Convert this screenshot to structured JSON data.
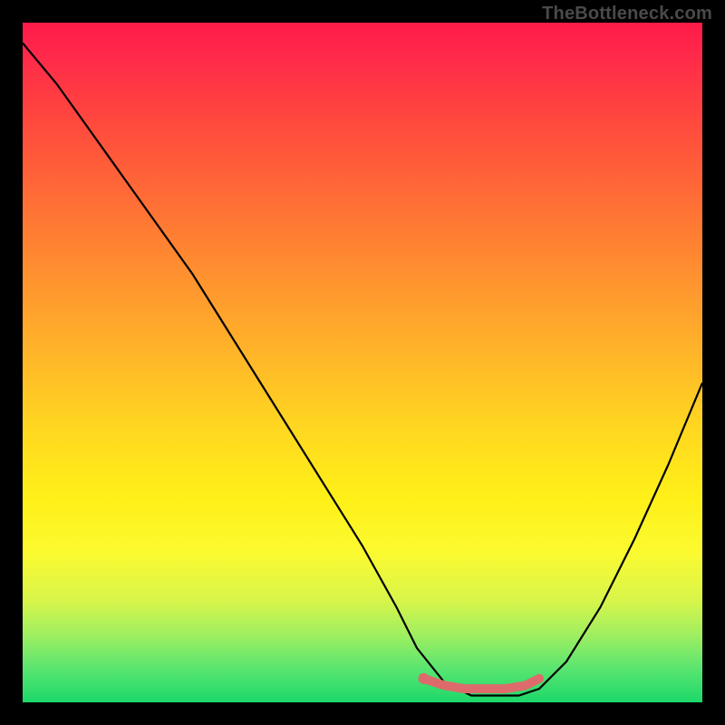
{
  "watermark": "TheBottleneck.com",
  "chart_data": {
    "type": "line",
    "title": "",
    "xlabel": "",
    "ylabel": "",
    "xlim": [
      0,
      100
    ],
    "ylim": [
      0,
      100
    ],
    "grid": false,
    "legend": false,
    "background_gradient": {
      "top": "#ff1a4a",
      "bottom": "#1cd86a",
      "meaning": "red (bad) to green (good)"
    },
    "series": [
      {
        "name": "curve",
        "color": "#000000",
        "x": [
          0,
          5,
          10,
          15,
          20,
          25,
          30,
          35,
          40,
          45,
          50,
          55,
          58,
          62,
          66,
          70,
          73,
          76,
          80,
          85,
          90,
          95,
          100
        ],
        "y": [
          97,
          91,
          84,
          77,
          70,
          63,
          55,
          47,
          39,
          31,
          23,
          14,
          8,
          3,
          1,
          1,
          1,
          2,
          6,
          14,
          24,
          35,
          47
        ]
      },
      {
        "name": "highlight",
        "color": "#e06a6a",
        "type": "scatter",
        "x": [
          59,
          62,
          65,
          68,
          71,
          74,
          76
        ],
        "y": [
          3.5,
          2.5,
          2,
          2,
          2,
          2.5,
          3.5
        ]
      }
    ]
  }
}
